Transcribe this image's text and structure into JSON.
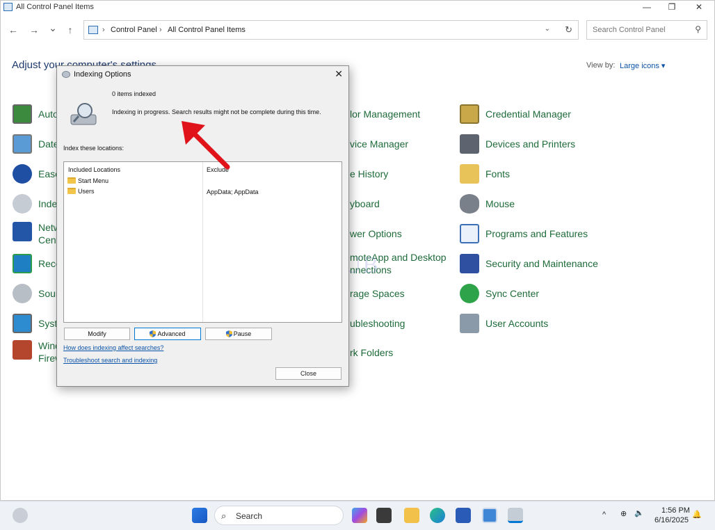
{
  "window": {
    "title": "All Control Panel Items",
    "minimize": "—",
    "maximize": "❐",
    "close": "✕"
  },
  "nav": {
    "back": "←",
    "forward": "→",
    "recent": "⌄",
    "up": "↑"
  },
  "address": {
    "crumb1": "Control Panel",
    "sep": "›",
    "crumb2": "All Control Panel Items",
    "dropdown": "⌄",
    "refresh": "↻"
  },
  "search": {
    "placeholder": "Search Control Panel"
  },
  "heading": "Adjust your computer's settings",
  "view_by": {
    "label": "View by:",
    "value": "Large icons ▾"
  },
  "col1": [
    "Auto",
    "Date",
    "Ease",
    "Inde",
    "Netw",
    "Cent",
    "Reco",
    "Sour",
    "Syste",
    "Wind",
    "Firew"
  ],
  "col2": [
    "lor Management",
    "vice Manager",
    "e History",
    "yboard",
    "wer Options",
    "moteApp and Desktop",
    "nnections",
    "rage Spaces",
    "ubleshooting",
    "rk Folders"
  ],
  "col3": [
    "Credential Manager",
    "Devices and Printers",
    "Fonts",
    "Mouse",
    "Programs and Features",
    "Security and Maintenance",
    "Sync Center",
    "User Accounts"
  ],
  "dialog": {
    "title": "Indexing Options",
    "close": "✕",
    "count": "0 items indexed",
    "status": "Indexing in progress. Search results might not be complete during this time.",
    "index_label": "Index these locations:",
    "col_included": "Included Locations",
    "col_exclude": "Exclude",
    "rows": [
      {
        "location": "Start Menu",
        "exclude": ""
      },
      {
        "location": "Users",
        "exclude": "AppData; AppData"
      }
    ],
    "btn_modify": "Modify",
    "btn_advanced": "Advanced",
    "btn_pause": "Pause",
    "link1": "How does indexing affect searches?",
    "link2": "Troubleshoot search and indexing",
    "btn_close": "Close"
  },
  "watermark": "IT ProHUB",
  "taskbar": {
    "search": "Search",
    "search_icon": "⌕",
    "chevron": "^",
    "time": "1:56 PM",
    "date": "6/16/2025"
  },
  "colors": {
    "link": "#1e6b3a",
    "accent": "#0078d4",
    "arrow": "#e0131a"
  }
}
